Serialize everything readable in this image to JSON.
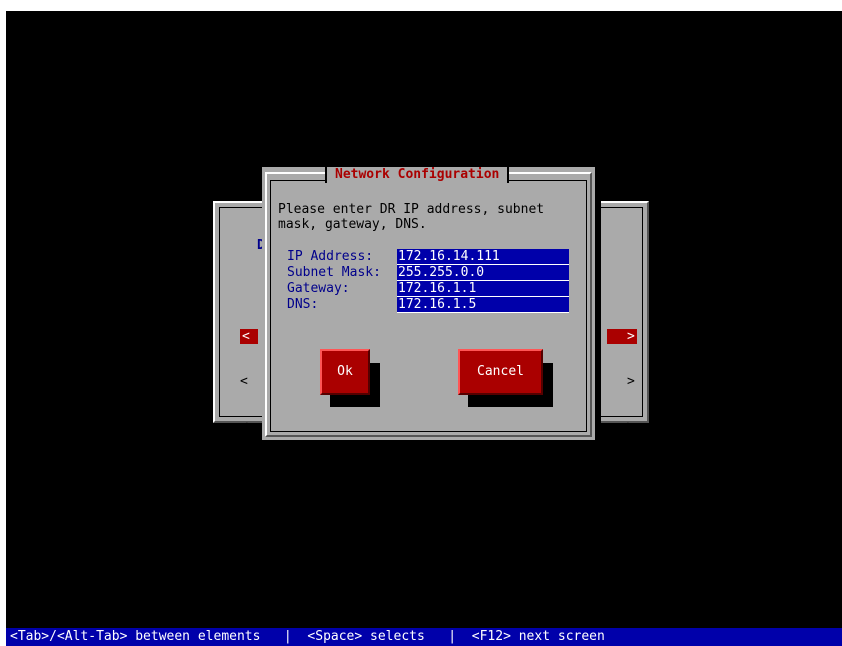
{
  "dialog": {
    "title": "Network Configuration",
    "prompt": "Please enter DR IP address, subnet mask, gateway, DNS.",
    "fields": [
      {
        "label": "IP Address:",
        "value": "172.16.14.111"
      },
      {
        "label": "Subnet Mask:",
        "value": "255.255.0.0"
      },
      {
        "label": "Gateway:",
        "value": "172.16.1.1"
      },
      {
        "label": "DNS:",
        "value": "172.16.1.5"
      }
    ],
    "ok_label": "Ok",
    "cancel_label": "Cancel"
  },
  "background_dialog": {
    "visible_letter": "D",
    "left_arrows": [
      "<",
      "<",
      "<",
      "<",
      "<",
      "<"
    ],
    "right_arrows": [
      ">",
      ">",
      ">",
      ">",
      ">",
      ">"
    ]
  },
  "statusbar": {
    "text": "<Tab>/<Alt-Tab> between elements   |  <Space> selects   |  <F12> next screen"
  },
  "colors": {
    "screen_bg": "#000000",
    "dialog_bg": "#aaaaaa",
    "title_red": "#aa0000",
    "input_blue": "#0000aa",
    "button_red": "#aa0000",
    "status_blue": "#0000aa"
  }
}
